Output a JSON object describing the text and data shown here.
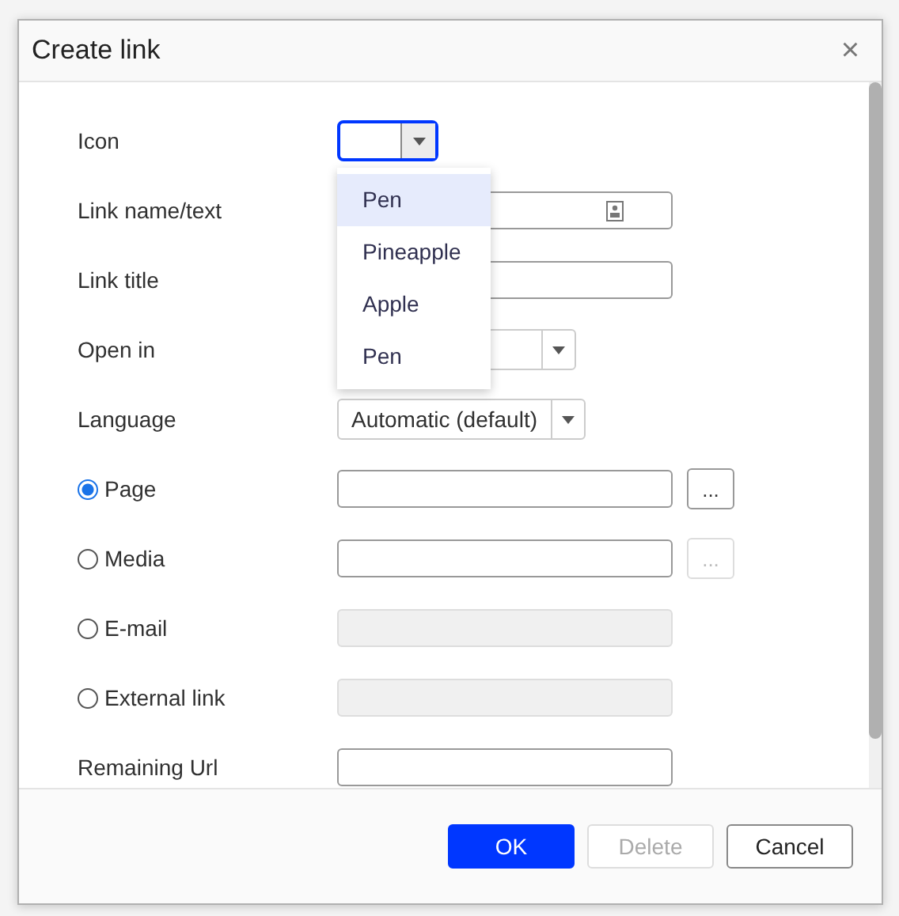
{
  "dialog": {
    "title": "Create link",
    "close": "×"
  },
  "rows": [
    {
      "kind": "icon_select",
      "label": "Icon",
      "open": true
    },
    {
      "kind": "input",
      "label": "Link name/text",
      "trailing_icon": true
    },
    {
      "kind": "input",
      "label": "Link title"
    },
    {
      "kind": "select",
      "label": "Open in"
    },
    {
      "kind": "select",
      "label": "Language",
      "value": "Automatic (default)"
    },
    {
      "kind": "radio",
      "label": "Page",
      "selected": true,
      "field_disabled": false,
      "browse": "...",
      "browse_disabled": false
    },
    {
      "kind": "radio",
      "label": "Media",
      "selected": false,
      "field_disabled": false,
      "browse": "...",
      "browse_disabled": true
    },
    {
      "kind": "radio",
      "label": "E-mail",
      "selected": false,
      "field_disabled": true
    },
    {
      "kind": "radio",
      "label": "External link",
      "selected": false,
      "field_disabled": true
    },
    {
      "kind": "input",
      "label": "Remaining Url"
    }
  ],
  "dropdown": {
    "options": [
      {
        "label": "Pen",
        "selected": true
      },
      {
        "label": "Pineapple",
        "selected": false
      },
      {
        "label": "Apple",
        "selected": false
      },
      {
        "label": "Pen",
        "selected": false
      }
    ]
  },
  "buttons": [
    {
      "label": "OK",
      "kind": "primary",
      "disabled": false
    },
    {
      "label": "Delete",
      "kind": "secondary",
      "disabled": true
    },
    {
      "label": "Cancel",
      "kind": "secondary",
      "disabled": false
    }
  ]
}
